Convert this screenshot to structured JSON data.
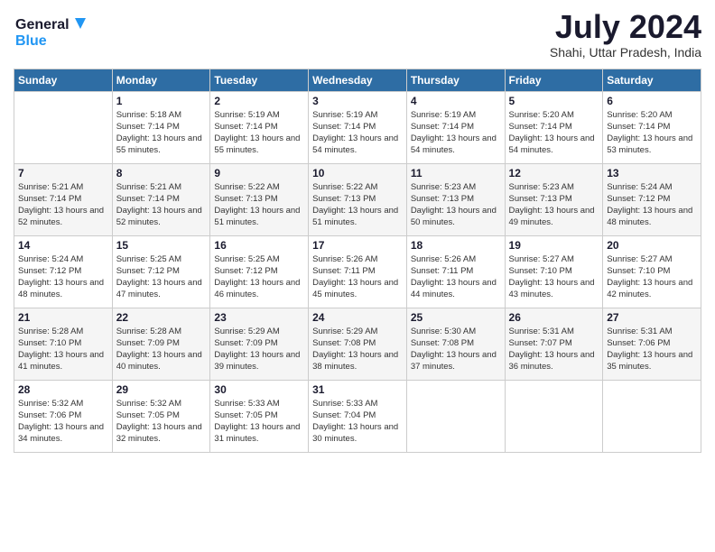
{
  "header": {
    "logo_line1": "General",
    "logo_line2": "Blue",
    "month_year": "July 2024",
    "location": "Shahi, Uttar Pradesh, India"
  },
  "weekdays": [
    "Sunday",
    "Monday",
    "Tuesday",
    "Wednesday",
    "Thursday",
    "Friday",
    "Saturday"
  ],
  "weeks": [
    [
      {
        "day": "",
        "sunrise": "",
        "sunset": "",
        "daylight": ""
      },
      {
        "day": "1",
        "sunrise": "Sunrise: 5:18 AM",
        "sunset": "Sunset: 7:14 PM",
        "daylight": "Daylight: 13 hours and 55 minutes."
      },
      {
        "day": "2",
        "sunrise": "Sunrise: 5:19 AM",
        "sunset": "Sunset: 7:14 PM",
        "daylight": "Daylight: 13 hours and 55 minutes."
      },
      {
        "day": "3",
        "sunrise": "Sunrise: 5:19 AM",
        "sunset": "Sunset: 7:14 PM",
        "daylight": "Daylight: 13 hours and 54 minutes."
      },
      {
        "day": "4",
        "sunrise": "Sunrise: 5:19 AM",
        "sunset": "Sunset: 7:14 PM",
        "daylight": "Daylight: 13 hours and 54 minutes."
      },
      {
        "day": "5",
        "sunrise": "Sunrise: 5:20 AM",
        "sunset": "Sunset: 7:14 PM",
        "daylight": "Daylight: 13 hours and 54 minutes."
      },
      {
        "day": "6",
        "sunrise": "Sunrise: 5:20 AM",
        "sunset": "Sunset: 7:14 PM",
        "daylight": "Daylight: 13 hours and 53 minutes."
      }
    ],
    [
      {
        "day": "7",
        "sunrise": "Sunrise: 5:21 AM",
        "sunset": "Sunset: 7:14 PM",
        "daylight": "Daylight: 13 hours and 52 minutes."
      },
      {
        "day": "8",
        "sunrise": "Sunrise: 5:21 AM",
        "sunset": "Sunset: 7:14 PM",
        "daylight": "Daylight: 13 hours and 52 minutes."
      },
      {
        "day": "9",
        "sunrise": "Sunrise: 5:22 AM",
        "sunset": "Sunset: 7:13 PM",
        "daylight": "Daylight: 13 hours and 51 minutes."
      },
      {
        "day": "10",
        "sunrise": "Sunrise: 5:22 AM",
        "sunset": "Sunset: 7:13 PM",
        "daylight": "Daylight: 13 hours and 51 minutes."
      },
      {
        "day": "11",
        "sunrise": "Sunrise: 5:23 AM",
        "sunset": "Sunset: 7:13 PM",
        "daylight": "Daylight: 13 hours and 50 minutes."
      },
      {
        "day": "12",
        "sunrise": "Sunrise: 5:23 AM",
        "sunset": "Sunset: 7:13 PM",
        "daylight": "Daylight: 13 hours and 49 minutes."
      },
      {
        "day": "13",
        "sunrise": "Sunrise: 5:24 AM",
        "sunset": "Sunset: 7:12 PM",
        "daylight": "Daylight: 13 hours and 48 minutes."
      }
    ],
    [
      {
        "day": "14",
        "sunrise": "Sunrise: 5:24 AM",
        "sunset": "Sunset: 7:12 PM",
        "daylight": "Daylight: 13 hours and 48 minutes."
      },
      {
        "day": "15",
        "sunrise": "Sunrise: 5:25 AM",
        "sunset": "Sunset: 7:12 PM",
        "daylight": "Daylight: 13 hours and 47 minutes."
      },
      {
        "day": "16",
        "sunrise": "Sunrise: 5:25 AM",
        "sunset": "Sunset: 7:12 PM",
        "daylight": "Daylight: 13 hours and 46 minutes."
      },
      {
        "day": "17",
        "sunrise": "Sunrise: 5:26 AM",
        "sunset": "Sunset: 7:11 PM",
        "daylight": "Daylight: 13 hours and 45 minutes."
      },
      {
        "day": "18",
        "sunrise": "Sunrise: 5:26 AM",
        "sunset": "Sunset: 7:11 PM",
        "daylight": "Daylight: 13 hours and 44 minutes."
      },
      {
        "day": "19",
        "sunrise": "Sunrise: 5:27 AM",
        "sunset": "Sunset: 7:10 PM",
        "daylight": "Daylight: 13 hours and 43 minutes."
      },
      {
        "day": "20",
        "sunrise": "Sunrise: 5:27 AM",
        "sunset": "Sunset: 7:10 PM",
        "daylight": "Daylight: 13 hours and 42 minutes."
      }
    ],
    [
      {
        "day": "21",
        "sunrise": "Sunrise: 5:28 AM",
        "sunset": "Sunset: 7:10 PM",
        "daylight": "Daylight: 13 hours and 41 minutes."
      },
      {
        "day": "22",
        "sunrise": "Sunrise: 5:28 AM",
        "sunset": "Sunset: 7:09 PM",
        "daylight": "Daylight: 13 hours and 40 minutes."
      },
      {
        "day": "23",
        "sunrise": "Sunrise: 5:29 AM",
        "sunset": "Sunset: 7:09 PM",
        "daylight": "Daylight: 13 hours and 39 minutes."
      },
      {
        "day": "24",
        "sunrise": "Sunrise: 5:29 AM",
        "sunset": "Sunset: 7:08 PM",
        "daylight": "Daylight: 13 hours and 38 minutes."
      },
      {
        "day": "25",
        "sunrise": "Sunrise: 5:30 AM",
        "sunset": "Sunset: 7:08 PM",
        "daylight": "Daylight: 13 hours and 37 minutes."
      },
      {
        "day": "26",
        "sunrise": "Sunrise: 5:31 AM",
        "sunset": "Sunset: 7:07 PM",
        "daylight": "Daylight: 13 hours and 36 minutes."
      },
      {
        "day": "27",
        "sunrise": "Sunrise: 5:31 AM",
        "sunset": "Sunset: 7:06 PM",
        "daylight": "Daylight: 13 hours and 35 minutes."
      }
    ],
    [
      {
        "day": "28",
        "sunrise": "Sunrise: 5:32 AM",
        "sunset": "Sunset: 7:06 PM",
        "daylight": "Daylight: 13 hours and 34 minutes."
      },
      {
        "day": "29",
        "sunrise": "Sunrise: 5:32 AM",
        "sunset": "Sunset: 7:05 PM",
        "daylight": "Daylight: 13 hours and 32 minutes."
      },
      {
        "day": "30",
        "sunrise": "Sunrise: 5:33 AM",
        "sunset": "Sunset: 7:05 PM",
        "daylight": "Daylight: 13 hours and 31 minutes."
      },
      {
        "day": "31",
        "sunrise": "Sunrise: 5:33 AM",
        "sunset": "Sunset: 7:04 PM",
        "daylight": "Daylight: 13 hours and 30 minutes."
      },
      {
        "day": "",
        "sunrise": "",
        "sunset": "",
        "daylight": ""
      },
      {
        "day": "",
        "sunrise": "",
        "sunset": "",
        "daylight": ""
      },
      {
        "day": "",
        "sunrise": "",
        "sunset": "",
        "daylight": ""
      }
    ]
  ]
}
